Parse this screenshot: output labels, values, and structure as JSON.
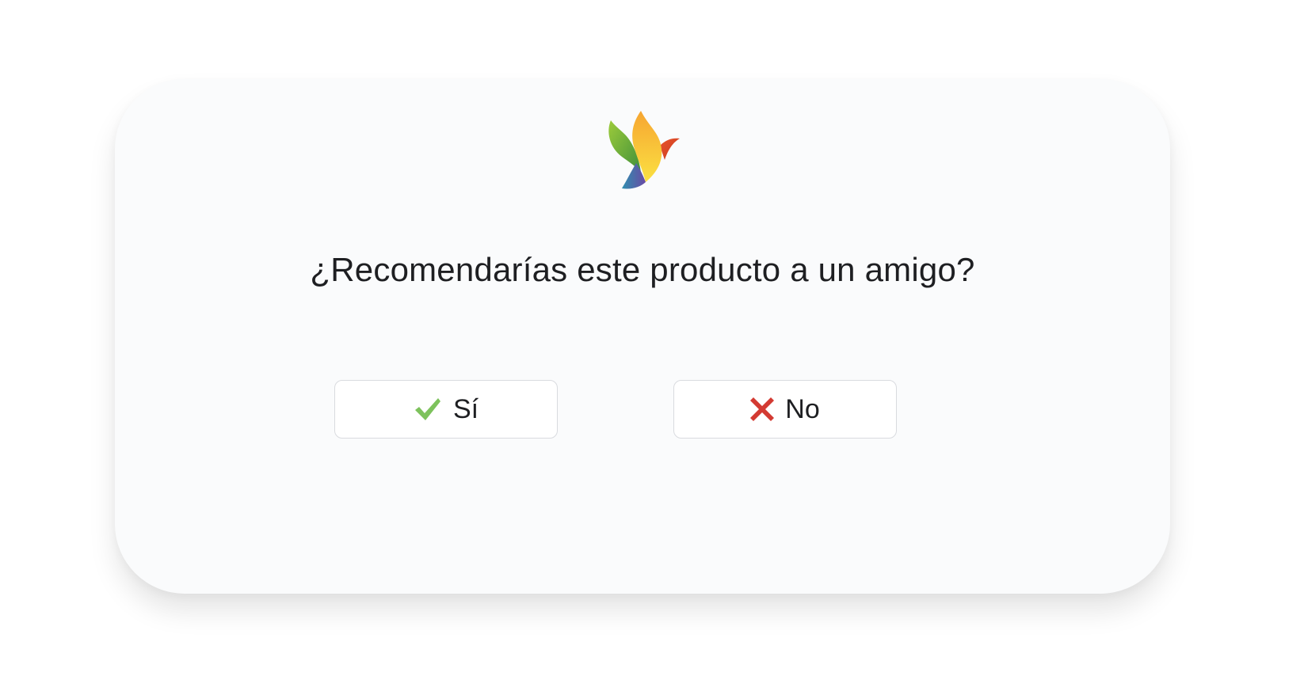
{
  "dialog": {
    "question": "¿Recomendarías este producto a un amigo?",
    "logo_icon": "bird-logo-icon"
  },
  "buttons": {
    "yes": {
      "label": "Sí",
      "icon": "check-icon",
      "icon_color": "#7dc25c"
    },
    "no": {
      "label": "No",
      "icon": "close-icon",
      "icon_color": "#d33a32"
    }
  },
  "colors": {
    "background": "#ffffff",
    "card": "#fafbfc",
    "text": "#1e1f22",
    "button_border": "#d9dbdf"
  }
}
